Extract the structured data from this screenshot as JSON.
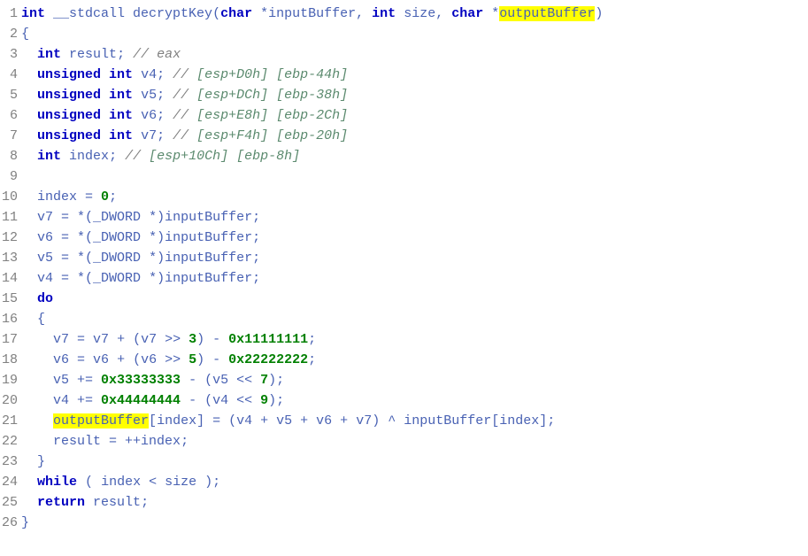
{
  "code": {
    "lines": [
      {
        "num": "1",
        "segments": [
          {
            "cls": "kw",
            "txt": "int"
          },
          {
            "cls": "",
            "txt": " "
          },
          {
            "cls": "ident",
            "txt": "__stdcall decryptKey"
          },
          {
            "cls": "punct",
            "txt": "("
          },
          {
            "cls": "kw",
            "txt": "char"
          },
          {
            "cls": "",
            "txt": " "
          },
          {
            "cls": "punct",
            "txt": "*"
          },
          {
            "cls": "ident",
            "txt": "inputBuffer"
          },
          {
            "cls": "punct",
            "txt": ", "
          },
          {
            "cls": "kw",
            "txt": "int"
          },
          {
            "cls": "",
            "txt": " "
          },
          {
            "cls": "ident",
            "txt": "size"
          },
          {
            "cls": "punct",
            "txt": ", "
          },
          {
            "cls": "kw",
            "txt": "char"
          },
          {
            "cls": "",
            "txt": " "
          },
          {
            "cls": "punct",
            "txt": "*"
          },
          {
            "cls": "highlight",
            "txt": "outputBuffer"
          },
          {
            "cls": "punct",
            "txt": ")"
          }
        ]
      },
      {
        "num": "2",
        "segments": [
          {
            "cls": "punct",
            "txt": "{"
          }
        ]
      },
      {
        "num": "3",
        "segments": [
          {
            "cls": "",
            "txt": "  "
          },
          {
            "cls": "kw",
            "txt": "int"
          },
          {
            "cls": "",
            "txt": " "
          },
          {
            "cls": "ident",
            "txt": "result"
          },
          {
            "cls": "punct",
            "txt": "; "
          },
          {
            "cls": "comment",
            "txt": "// eax"
          }
        ]
      },
      {
        "num": "4",
        "segments": [
          {
            "cls": "",
            "txt": "  "
          },
          {
            "cls": "kw",
            "txt": "unsigned"
          },
          {
            "cls": "",
            "txt": " "
          },
          {
            "cls": "kw",
            "txt": "int"
          },
          {
            "cls": "",
            "txt": " "
          },
          {
            "cls": "ident",
            "txt": "v4"
          },
          {
            "cls": "punct",
            "txt": "; "
          },
          {
            "cls": "comment",
            "txt": "// "
          },
          {
            "cls": "comment-offset",
            "txt": "[esp+D0h] [ebp-44h]"
          }
        ]
      },
      {
        "num": "5",
        "segments": [
          {
            "cls": "",
            "txt": "  "
          },
          {
            "cls": "kw",
            "txt": "unsigned"
          },
          {
            "cls": "",
            "txt": " "
          },
          {
            "cls": "kw",
            "txt": "int"
          },
          {
            "cls": "",
            "txt": " "
          },
          {
            "cls": "ident",
            "txt": "v5"
          },
          {
            "cls": "punct",
            "txt": "; "
          },
          {
            "cls": "comment",
            "txt": "// "
          },
          {
            "cls": "comment-offset",
            "txt": "[esp+DCh] [ebp-38h]"
          }
        ]
      },
      {
        "num": "6",
        "segments": [
          {
            "cls": "",
            "txt": "  "
          },
          {
            "cls": "kw",
            "txt": "unsigned"
          },
          {
            "cls": "",
            "txt": " "
          },
          {
            "cls": "kw",
            "txt": "int"
          },
          {
            "cls": "",
            "txt": " "
          },
          {
            "cls": "ident",
            "txt": "v6"
          },
          {
            "cls": "punct",
            "txt": "; "
          },
          {
            "cls": "comment",
            "txt": "// "
          },
          {
            "cls": "comment-offset",
            "txt": "[esp+E8h] [ebp-2Ch]"
          }
        ]
      },
      {
        "num": "7",
        "segments": [
          {
            "cls": "",
            "txt": "  "
          },
          {
            "cls": "kw",
            "txt": "unsigned"
          },
          {
            "cls": "",
            "txt": " "
          },
          {
            "cls": "kw",
            "txt": "int"
          },
          {
            "cls": "",
            "txt": " "
          },
          {
            "cls": "ident",
            "txt": "v7"
          },
          {
            "cls": "punct",
            "txt": "; "
          },
          {
            "cls": "comment",
            "txt": "// "
          },
          {
            "cls": "comment-offset",
            "txt": "[esp+F4h] [ebp-20h]"
          }
        ]
      },
      {
        "num": "8",
        "segments": [
          {
            "cls": "",
            "txt": "  "
          },
          {
            "cls": "kw",
            "txt": "int"
          },
          {
            "cls": "",
            "txt": " "
          },
          {
            "cls": "ident",
            "txt": "index"
          },
          {
            "cls": "punct",
            "txt": "; "
          },
          {
            "cls": "comment",
            "txt": "// "
          },
          {
            "cls": "comment-offset",
            "txt": "[esp+10Ch] [ebp-8h]"
          }
        ]
      },
      {
        "num": "9",
        "segments": []
      },
      {
        "num": "10",
        "segments": [
          {
            "cls": "",
            "txt": "  "
          },
          {
            "cls": "ident",
            "txt": "index "
          },
          {
            "cls": "punct",
            "txt": "= "
          },
          {
            "cls": "number",
            "txt": "0"
          },
          {
            "cls": "punct",
            "txt": ";"
          }
        ]
      },
      {
        "num": "11",
        "segments": [
          {
            "cls": "",
            "txt": "  "
          },
          {
            "cls": "ident",
            "txt": "v7 "
          },
          {
            "cls": "punct",
            "txt": "= *("
          },
          {
            "cls": "ident",
            "txt": "_DWORD "
          },
          {
            "cls": "punct",
            "txt": "*)"
          },
          {
            "cls": "ident",
            "txt": "inputBuffer"
          },
          {
            "cls": "punct",
            "txt": ";"
          }
        ]
      },
      {
        "num": "12",
        "segments": [
          {
            "cls": "",
            "txt": "  "
          },
          {
            "cls": "ident",
            "txt": "v6 "
          },
          {
            "cls": "punct",
            "txt": "= *("
          },
          {
            "cls": "ident",
            "txt": "_DWORD "
          },
          {
            "cls": "punct",
            "txt": "*)"
          },
          {
            "cls": "ident",
            "txt": "inputBuffer"
          },
          {
            "cls": "punct",
            "txt": ";"
          }
        ]
      },
      {
        "num": "13",
        "segments": [
          {
            "cls": "",
            "txt": "  "
          },
          {
            "cls": "ident",
            "txt": "v5 "
          },
          {
            "cls": "punct",
            "txt": "= *("
          },
          {
            "cls": "ident",
            "txt": "_DWORD "
          },
          {
            "cls": "punct",
            "txt": "*)"
          },
          {
            "cls": "ident",
            "txt": "inputBuffer"
          },
          {
            "cls": "punct",
            "txt": ";"
          }
        ]
      },
      {
        "num": "14",
        "segments": [
          {
            "cls": "",
            "txt": "  "
          },
          {
            "cls": "ident",
            "txt": "v4 "
          },
          {
            "cls": "punct",
            "txt": "= *("
          },
          {
            "cls": "ident",
            "txt": "_DWORD "
          },
          {
            "cls": "punct",
            "txt": "*)"
          },
          {
            "cls": "ident",
            "txt": "inputBuffer"
          },
          {
            "cls": "punct",
            "txt": ";"
          }
        ]
      },
      {
        "num": "15",
        "segments": [
          {
            "cls": "",
            "txt": "  "
          },
          {
            "cls": "kw",
            "txt": "do"
          }
        ]
      },
      {
        "num": "16",
        "segments": [
          {
            "cls": "",
            "txt": "  "
          },
          {
            "cls": "punct",
            "txt": "{"
          }
        ]
      },
      {
        "num": "17",
        "segments": [
          {
            "cls": "",
            "txt": "    "
          },
          {
            "cls": "ident",
            "txt": "v7 "
          },
          {
            "cls": "punct",
            "txt": "= "
          },
          {
            "cls": "ident",
            "txt": "v7 "
          },
          {
            "cls": "punct",
            "txt": "+ ("
          },
          {
            "cls": "ident",
            "txt": "v7 "
          },
          {
            "cls": "punct",
            "txt": ">> "
          },
          {
            "cls": "number",
            "txt": "3"
          },
          {
            "cls": "punct",
            "txt": ") - "
          },
          {
            "cls": "number",
            "txt": "0x11111111"
          },
          {
            "cls": "punct",
            "txt": ";"
          }
        ]
      },
      {
        "num": "18",
        "segments": [
          {
            "cls": "",
            "txt": "    "
          },
          {
            "cls": "ident",
            "txt": "v6 "
          },
          {
            "cls": "punct",
            "txt": "= "
          },
          {
            "cls": "ident",
            "txt": "v6 "
          },
          {
            "cls": "punct",
            "txt": "+ ("
          },
          {
            "cls": "ident",
            "txt": "v6 "
          },
          {
            "cls": "punct",
            "txt": ">> "
          },
          {
            "cls": "number",
            "txt": "5"
          },
          {
            "cls": "punct",
            "txt": ") - "
          },
          {
            "cls": "number",
            "txt": "0x22222222"
          },
          {
            "cls": "punct",
            "txt": ";"
          }
        ]
      },
      {
        "num": "19",
        "segments": [
          {
            "cls": "",
            "txt": "    "
          },
          {
            "cls": "ident",
            "txt": "v5 "
          },
          {
            "cls": "punct",
            "txt": "+= "
          },
          {
            "cls": "number",
            "txt": "0x33333333"
          },
          {
            "cls": "punct",
            "txt": " - ("
          },
          {
            "cls": "ident",
            "txt": "v5 "
          },
          {
            "cls": "punct",
            "txt": "<< "
          },
          {
            "cls": "number",
            "txt": "7"
          },
          {
            "cls": "punct",
            "txt": ");"
          }
        ]
      },
      {
        "num": "20",
        "segments": [
          {
            "cls": "",
            "txt": "    "
          },
          {
            "cls": "ident",
            "txt": "v4 "
          },
          {
            "cls": "punct",
            "txt": "+= "
          },
          {
            "cls": "number",
            "txt": "0x44444444"
          },
          {
            "cls": "punct",
            "txt": " - ("
          },
          {
            "cls": "ident",
            "txt": "v4 "
          },
          {
            "cls": "punct",
            "txt": "<< "
          },
          {
            "cls": "number",
            "txt": "9"
          },
          {
            "cls": "punct",
            "txt": ");"
          }
        ]
      },
      {
        "num": "21",
        "segments": [
          {
            "cls": "",
            "txt": "    "
          },
          {
            "cls": "highlight",
            "txt": "outputBuffer"
          },
          {
            "cls": "punct",
            "txt": "["
          },
          {
            "cls": "ident",
            "txt": "index"
          },
          {
            "cls": "punct",
            "txt": "] = ("
          },
          {
            "cls": "ident",
            "txt": "v4 "
          },
          {
            "cls": "punct",
            "txt": "+ "
          },
          {
            "cls": "ident",
            "txt": "v5 "
          },
          {
            "cls": "punct",
            "txt": "+ "
          },
          {
            "cls": "ident",
            "txt": "v6 "
          },
          {
            "cls": "punct",
            "txt": "+ "
          },
          {
            "cls": "ident",
            "txt": "v7"
          },
          {
            "cls": "punct",
            "txt": ") ^ "
          },
          {
            "cls": "ident",
            "txt": "inputBuffer"
          },
          {
            "cls": "punct",
            "txt": "["
          },
          {
            "cls": "ident",
            "txt": "index"
          },
          {
            "cls": "punct",
            "txt": "];"
          }
        ]
      },
      {
        "num": "22",
        "segments": [
          {
            "cls": "",
            "txt": "    "
          },
          {
            "cls": "ident",
            "txt": "result "
          },
          {
            "cls": "punct",
            "txt": "= ++"
          },
          {
            "cls": "ident",
            "txt": "index"
          },
          {
            "cls": "punct",
            "txt": ";"
          }
        ]
      },
      {
        "num": "23",
        "segments": [
          {
            "cls": "",
            "txt": "  "
          },
          {
            "cls": "punct",
            "txt": "}"
          }
        ]
      },
      {
        "num": "24",
        "segments": [
          {
            "cls": "",
            "txt": "  "
          },
          {
            "cls": "kw",
            "txt": "while"
          },
          {
            "cls": "",
            "txt": " "
          },
          {
            "cls": "punct",
            "txt": "( "
          },
          {
            "cls": "ident",
            "txt": "index "
          },
          {
            "cls": "punct",
            "txt": "< "
          },
          {
            "cls": "ident",
            "txt": "size "
          },
          {
            "cls": "punct",
            "txt": ");"
          }
        ]
      },
      {
        "num": "25",
        "segments": [
          {
            "cls": "",
            "txt": "  "
          },
          {
            "cls": "kw",
            "txt": "return"
          },
          {
            "cls": "",
            "txt": " "
          },
          {
            "cls": "ident",
            "txt": "result"
          },
          {
            "cls": "punct",
            "txt": ";"
          }
        ]
      },
      {
        "num": "26",
        "segments": [
          {
            "cls": "punct",
            "txt": "}"
          }
        ]
      }
    ]
  }
}
